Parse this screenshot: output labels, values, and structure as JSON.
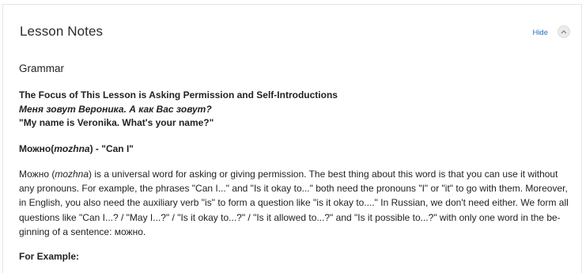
{
  "header": {
    "title": "Lesson Notes",
    "hide_label": "Hide"
  },
  "content": {
    "section": "Grammar",
    "focus_title": "The Focus of This Lesson is Asking Permission and Self-Introductions",
    "focus_russian": "Меня зовут Вероника. А как Вас зовут?",
    "focus_english": "\"My name is Veronika. What's your name?\"",
    "subhead_word": "Можно(",
    "subhead_translit": "mozhna",
    "subhead_rest": ") - \"Can I\"",
    "para_word": "Можно (",
    "para_translit": "mozhna",
    "para_lines": [
      ") is a universal word for asking or giving permission. The best thing about this word is that you can use it without",
      "any pronouns. For example, the phrases \"Can I...\" and \"Is it okay to...\" both need the pronouns \"I\" or \"it\" to go with them. Moreover,",
      "in English, you also need the auxiliary verb \"is\" to form a question like \"is it okay to....\" In Russian, we don't need either. We form all",
      "questions like \"Can I...? / \"May I...?\" / \"Is it okay to...?\" / \"Is it allowed to...?\" and \"Is it possible to...?\"  with only one word in the be-",
      "ginning of a sentence: можно."
    ],
    "example_label": "For Example:"
  }
}
